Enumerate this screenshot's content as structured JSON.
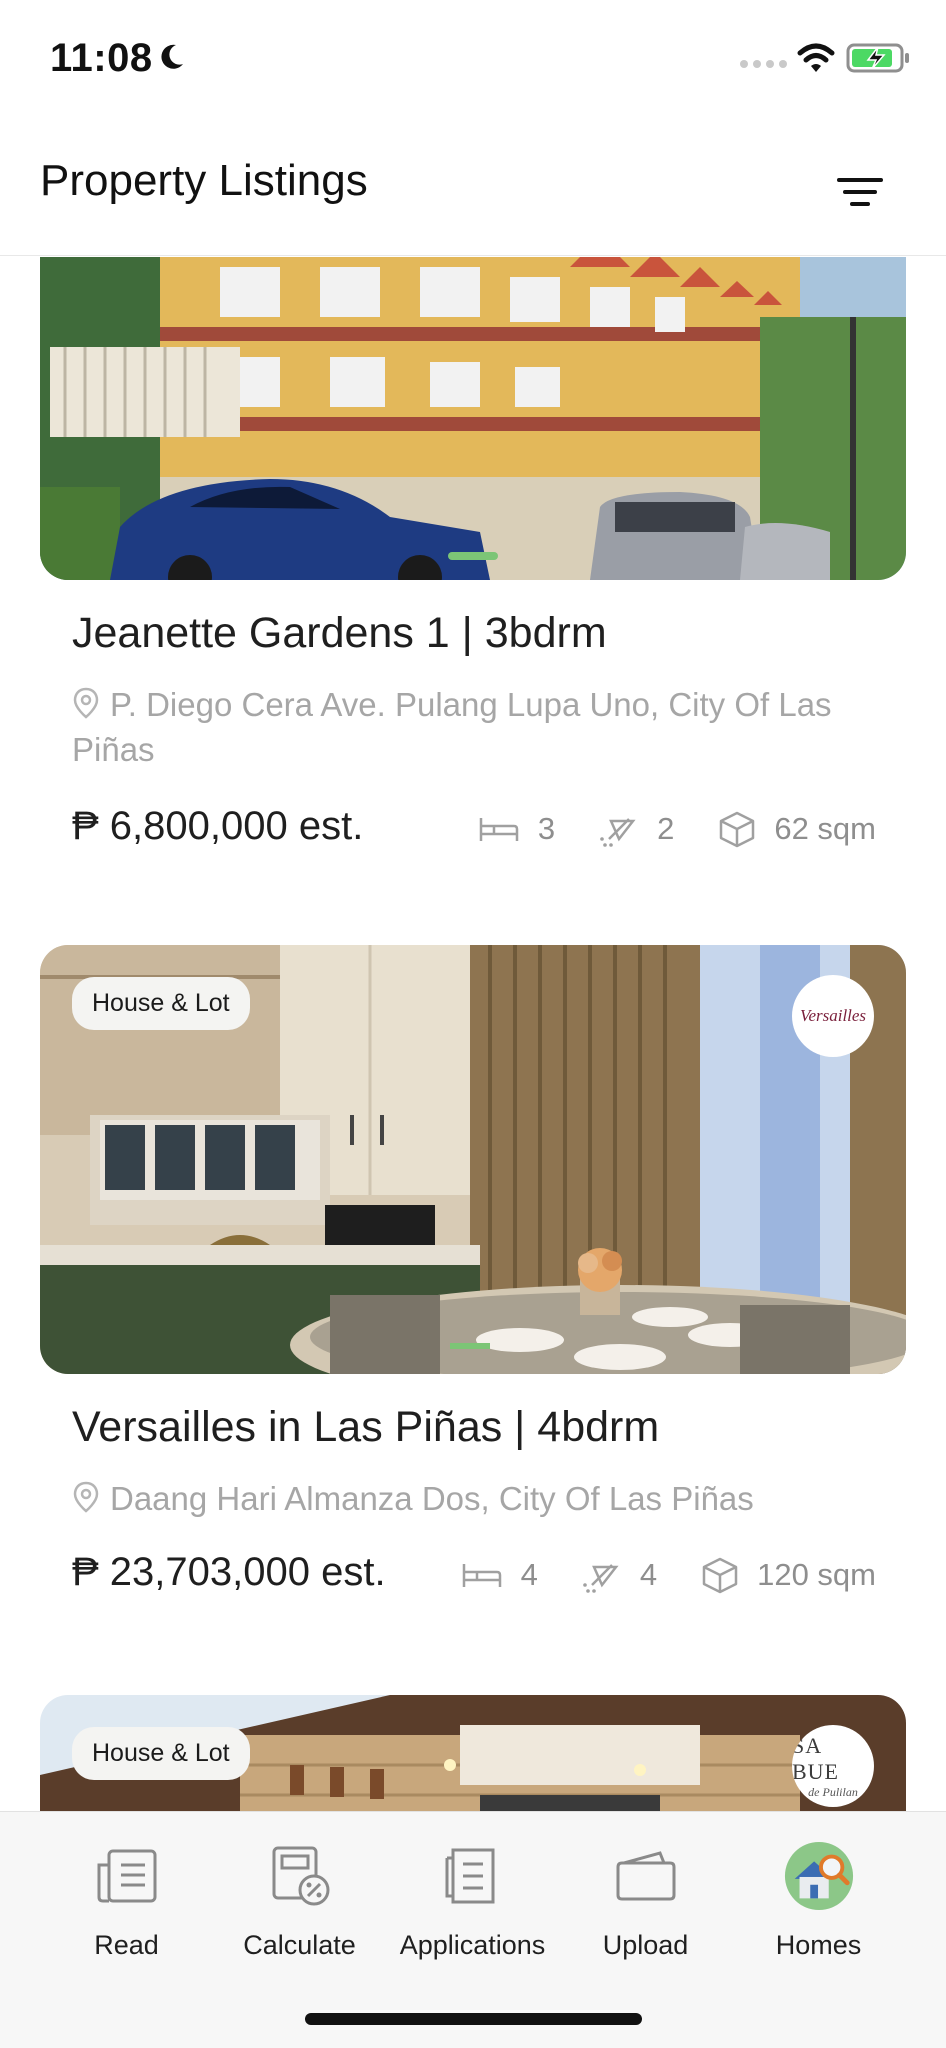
{
  "status_bar": {
    "time": "11:08"
  },
  "header": {
    "title": "Property Listings",
    "filter_icon": "filter-icon"
  },
  "colors": {
    "accent_green": "#7cc576",
    "text_primary": "#1f1f1f",
    "text_muted": "#a6a6a6",
    "spec_gray": "#8e8e8e",
    "nav_background": "#f7f7f7"
  },
  "listings": [
    {
      "tag": "",
      "title": "Jeanette Gardens 1 | 3bdrm",
      "address": "P. Diego Cera Ave. Pulang Lupa Uno, City Of Las Piñas",
      "price": "₱ 6,800,000 est.",
      "bedrooms": "3",
      "bathrooms": "2",
      "area": "62 sqm"
    },
    {
      "tag": "House & Lot",
      "developer_logo": "Versailles",
      "title": "Versailles in Las Piñas | 4bdrm",
      "address": "Daang Hari Almanza Dos, City Of Las Piñas",
      "price": "₱ 23,703,000 est.",
      "bedrooms": "4",
      "bathrooms": "4",
      "area": "120 sqm"
    },
    {
      "tag": "House & Lot",
      "developer_logo_line1": "SA BUE",
      "developer_logo_line2": "de Pulilan"
    }
  ],
  "bottom_nav": {
    "items": [
      {
        "label": "Read",
        "icon": "read-icon"
      },
      {
        "label": "Calculate",
        "icon": "calculate-icon"
      },
      {
        "label": "Applications",
        "icon": "applications-icon"
      },
      {
        "label": "Upload",
        "icon": "upload-icon"
      },
      {
        "label": "Homes",
        "icon": "homes-icon"
      }
    ]
  }
}
